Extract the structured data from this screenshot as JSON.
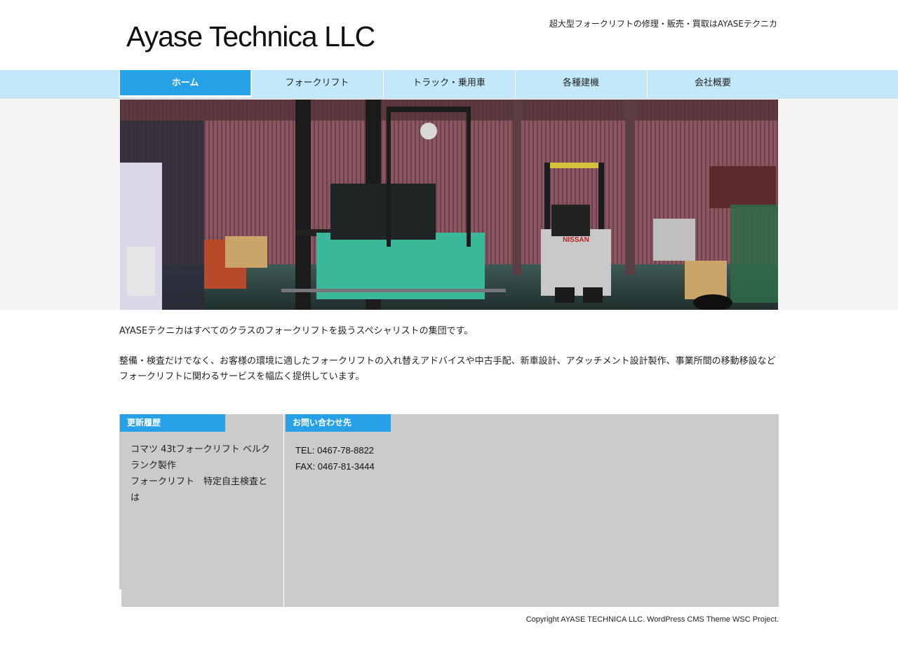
{
  "header": {
    "site_title": "Ayase Technica LLC",
    "tagline": "超大型フォークリフトの修理・販売・買取はAYASEテクニカ"
  },
  "nav": {
    "items": [
      {
        "label": "ホーム",
        "active": true
      },
      {
        "label": "フォークリフト",
        "active": false
      },
      {
        "label": "トラック・乗用車",
        "active": false
      },
      {
        "label": "各種建機",
        "active": false
      },
      {
        "label": "会社概要",
        "active": false
      }
    ],
    "active_color": "#26a1e8",
    "bar_color": "#c2e9f9"
  },
  "hero": {
    "forklift_brand": "NISSAN"
  },
  "intro": {
    "p1": "AYASEテクニカはすべてのクラスのフォークリフトを扱うスペシャリストの集団です。",
    "p2": "整備・検査だけでなく、お客様の環境に適したフォークリフトの入れ替えアドバイスや中古手配、新車設計、アタッチメント設計製作、事業所間の移動移設など",
    "p3": "フォークリフトに関わるサービスを幅広く提供しています。"
  },
  "widgets": {
    "news": {
      "title": "更新履歴",
      "items": [
        "コマツ 43tフォークリフト ベルクランク製作",
        "フォークリフト　特定自主検査とは"
      ]
    },
    "contact": {
      "title": "お問い合わせ先",
      "tel": "TEL: 0467-78-8822",
      "fax": "FAX: 0467-81-3444"
    }
  },
  "footer": {
    "copyright": "Copyright AYASE TECHNICA LLC. WordPress CMS Theme WSC Project."
  }
}
